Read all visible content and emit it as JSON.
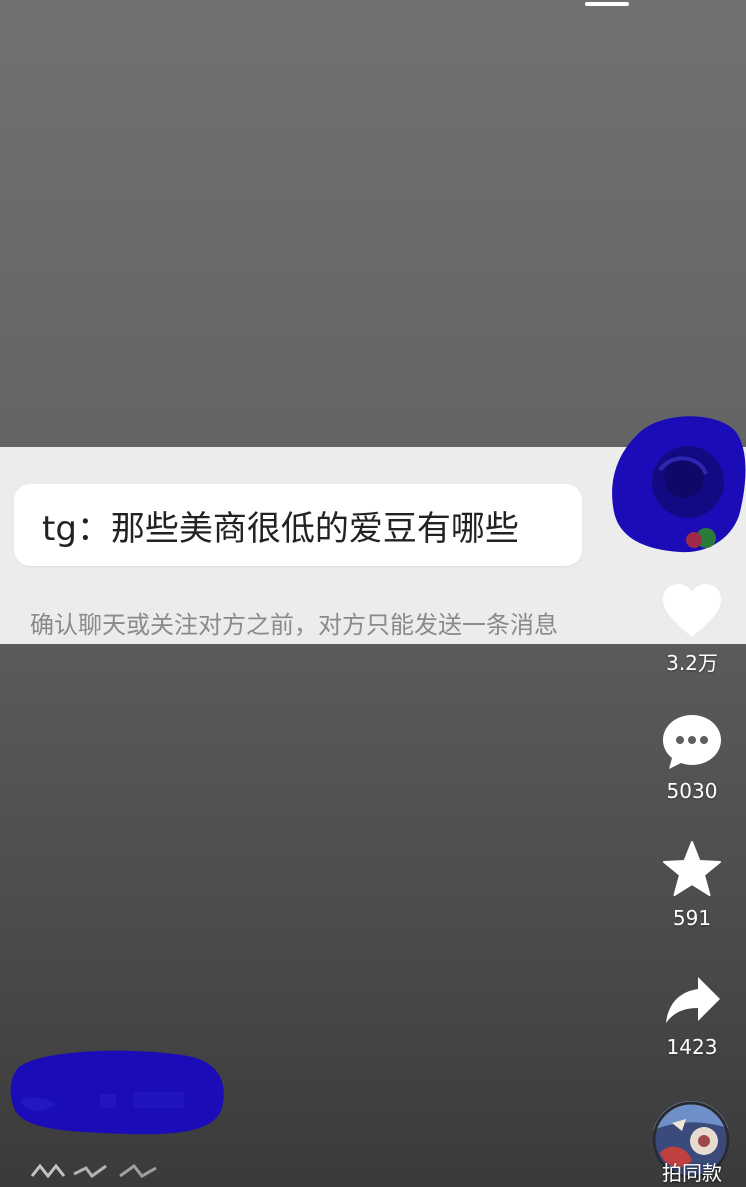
{
  "status": {
    "top_indicator": "home-indicator"
  },
  "message": {
    "text": "tg：那些美商很低的爱豆有哪些",
    "hint": "确认聊天或关注对方之前，对方只能发送一条消息"
  },
  "actions": {
    "like": {
      "icon": "heart-icon",
      "count": "3.2万"
    },
    "comment": {
      "icon": "comment-icon",
      "count": "5030"
    },
    "favorite": {
      "icon": "star-icon",
      "count": "591"
    },
    "share": {
      "icon": "share-icon",
      "count": "1423"
    },
    "same_style": {
      "icon": "music-disc-icon",
      "label": "拍同款"
    }
  },
  "redaction": {
    "color": "#1a0db8"
  }
}
